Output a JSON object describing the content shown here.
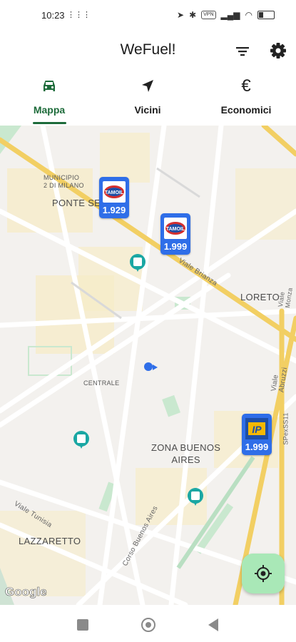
{
  "status_bar": {
    "time": "10:23",
    "vpn": "VPN",
    "icons": [
      "location-icon",
      "bluetooth-icon",
      "signal-icon",
      "wifi-icon",
      "battery-icon"
    ]
  },
  "app_bar": {
    "title": "WeFuel!",
    "actions": [
      "filter-icon",
      "gear-icon"
    ]
  },
  "tabs": [
    {
      "label": "Mappa",
      "icon": "car-icon",
      "active": true
    },
    {
      "label": "Vicini",
      "icon": "navigation-arrow-icon",
      "active": false
    },
    {
      "label": "Economici",
      "icon": "euro-icon",
      "active": false
    }
  ],
  "map": {
    "labels": {
      "municipio": "MUNICIPIO\n2 DI MILANO",
      "ponte": "PONTE SE",
      "loreto": "LORETO",
      "centrale": "CENTRALE",
      "buenos_aires": "ZONA BUENOS\nAIRES",
      "lazzaretto": "LAZZARETTO",
      "viale_brianza": "Viale Brianza",
      "viale_tunisia": "Viale Tunisia",
      "corso_buenos_aires": "Corso Buenos Aires",
      "viale_abruzzi": "Viale Abruzzi",
      "viale_monza": "Viale Monza",
      "sp_exss11": "SPexSS11"
    },
    "stations": [
      {
        "brand": "TAMOIL",
        "price": "1.929"
      },
      {
        "brand": "TAMOIL",
        "price": "1.999"
      },
      {
        "brand": "IP",
        "price": "1.999"
      }
    ],
    "attribution": "Google",
    "colors": {
      "marker": "#2f6ee8",
      "poi": "#1aa7a3",
      "accent": "#1d6b3a",
      "fab": "#a9e8b7"
    }
  },
  "fab": {
    "icon": "my-location-icon"
  },
  "nav_bar": {
    "buttons": [
      "recents-button",
      "home-button",
      "back-button"
    ]
  }
}
